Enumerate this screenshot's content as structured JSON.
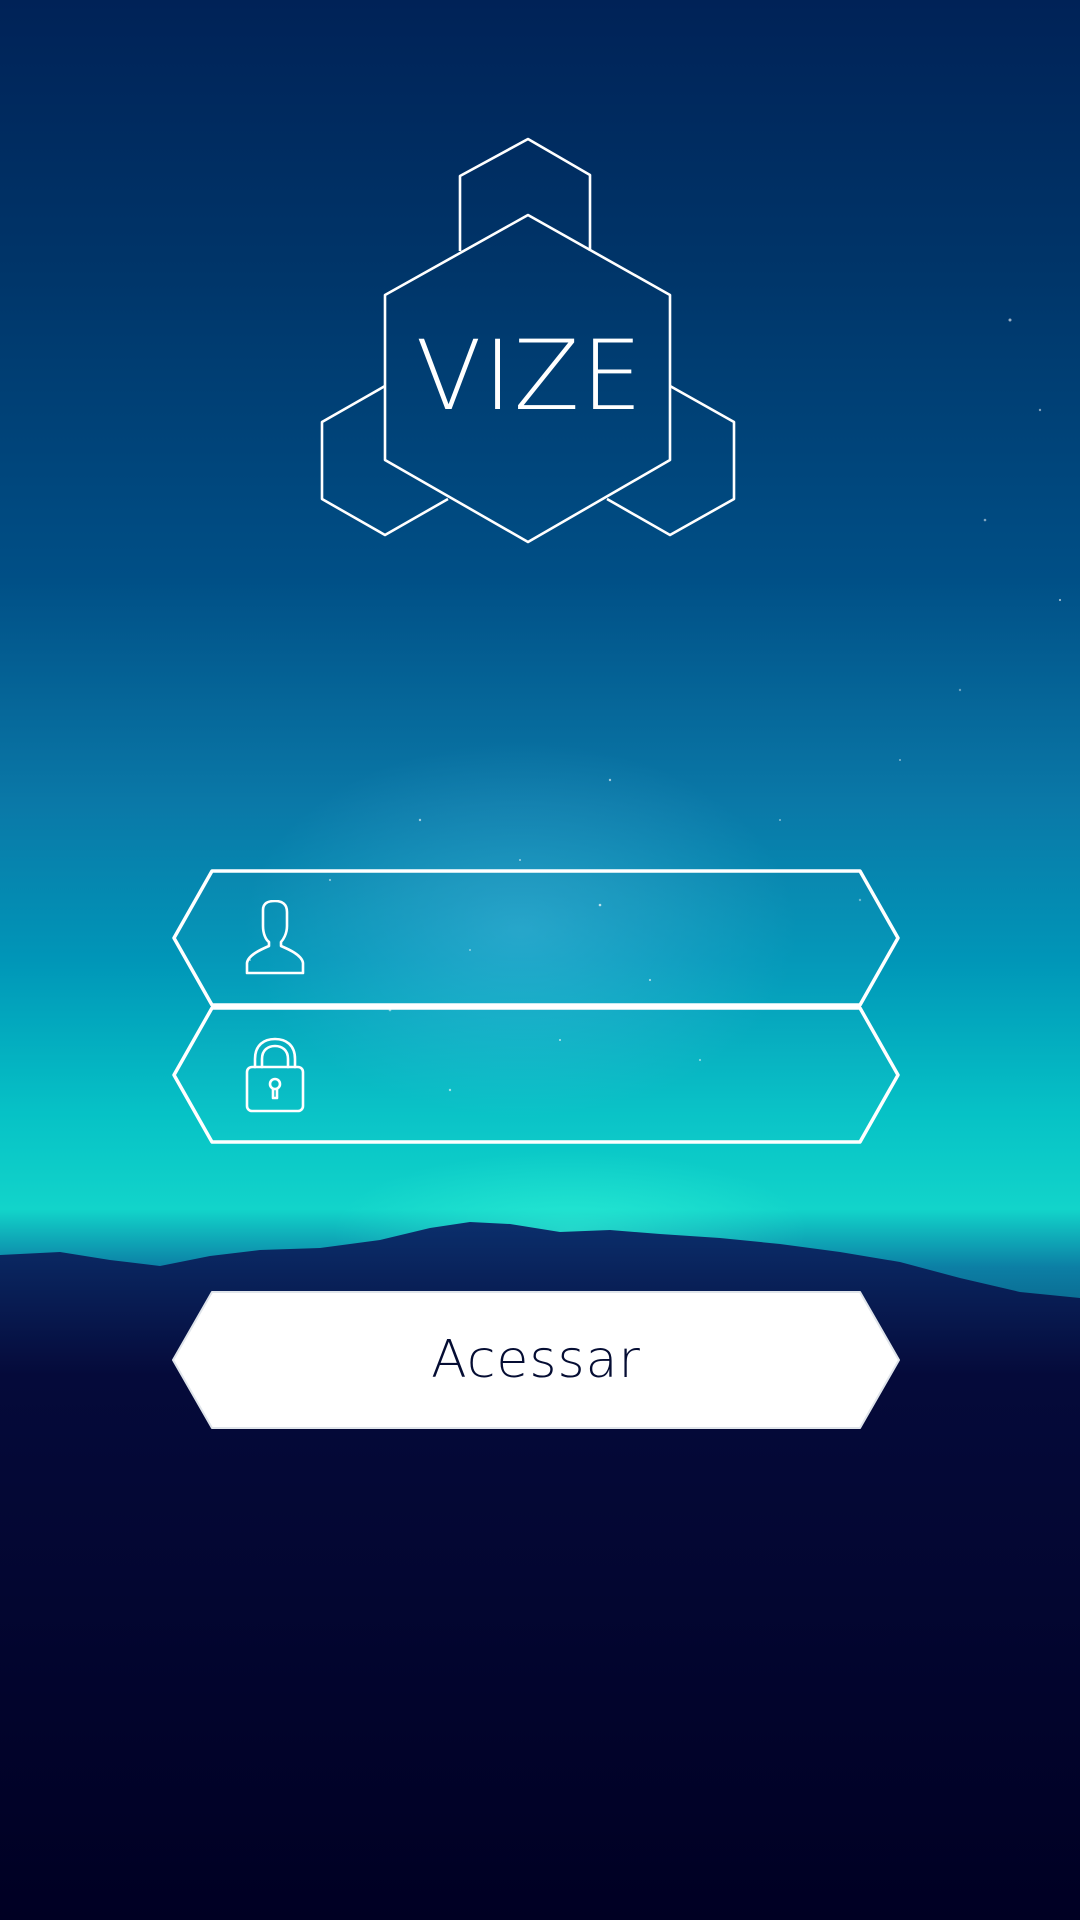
{
  "logo": {
    "text": "VIZE",
    "icon": "hexagon-cluster-logo"
  },
  "form": {
    "username": {
      "icon": "user-icon",
      "value": "",
      "placeholder": ""
    },
    "password": {
      "icon": "lock-icon",
      "value": "",
      "placeholder": ""
    }
  },
  "submit": {
    "label": "Acessar"
  },
  "colors": {
    "outline": "#ffffff",
    "button_bg": "#ffffff",
    "button_text": "#050d33",
    "sky_top": "#002257",
    "sky_glow": "#12d4ca",
    "ground": "#000023"
  }
}
